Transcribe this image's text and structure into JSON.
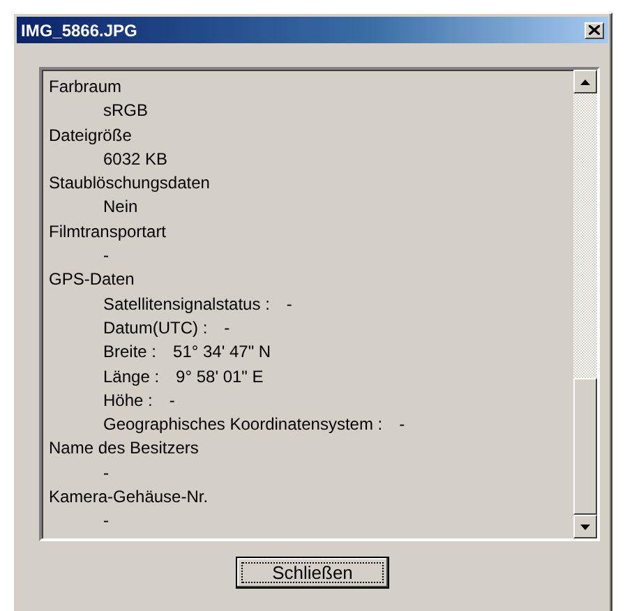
{
  "window": {
    "title": "IMG_5866.JPG"
  },
  "entries": [
    {
      "label": "Farbraum",
      "lines": [
        {
          "value": "sRGB"
        }
      ]
    },
    {
      "label": "Dateigröße",
      "lines": [
        {
          "value": "6032 KB"
        }
      ]
    },
    {
      "label": "Staublöschungsdaten",
      "lines": [
        {
          "value": "Nein"
        }
      ]
    },
    {
      "label": "Filmtransportart",
      "lines": [
        {
          "value": "-"
        }
      ]
    },
    {
      "label": "GPS-Daten",
      "lines": [
        {
          "name": "Satellitensignalstatus :",
          "value": "-"
        },
        {
          "name": "Datum(UTC) :",
          "value": "-"
        },
        {
          "name": "Breite :",
          "value": "51° 34' 47\" N"
        },
        {
          "name": "Länge :",
          "value": "9° 58' 01\" E"
        },
        {
          "name": "Höhe :",
          "value": "-"
        },
        {
          "name": "Geographisches Koordinatensystem :",
          "value": "-"
        }
      ]
    },
    {
      "label": "Name des Besitzers",
      "lines": [
        {
          "value": "-"
        }
      ]
    },
    {
      "label": "Kamera-Gehäuse-Nr.",
      "lines": [
        {
          "value": "-"
        }
      ]
    }
  ],
  "buttons": [
    {
      "label": "Schließen"
    }
  ]
}
